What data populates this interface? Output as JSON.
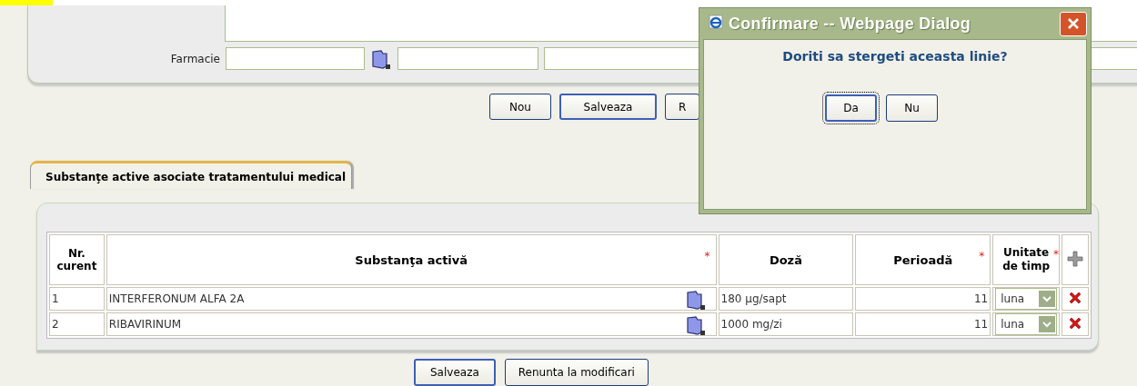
{
  "form": {
    "farmacie": {
      "label": "Farmacie"
    },
    "buttons": [
      {
        "label": "Nou",
        "default": false
      },
      {
        "label": "Salveaza",
        "default": true
      },
      {
        "label": "R",
        "default": false
      }
    ]
  },
  "tabs": [
    {
      "label": "Substanţe active asociate tratamentului medical",
      "selected": true
    }
  ],
  "table": {
    "columns": [
      {
        "label": "Nr. curent"
      },
      {
        "label": "Substanţa activă",
        "required_mark": "*"
      },
      {
        "label": "Doză"
      },
      {
        "label": "Perioadă",
        "required_mark": "*"
      },
      {
        "label": "Unitate de timp",
        "required_mark": "*"
      }
    ],
    "rows": [
      {
        "nr": "1",
        "substanta": "INTERFERONUM ALFA 2A",
        "doza": "180 µg/sapt",
        "perioada": "11",
        "unitate": "luna"
      },
      {
        "nr": "2",
        "substanta": "RIBAVIRINUM",
        "doza": "1000 mg/zi",
        "perioada": "11",
        "unitate": "luna"
      }
    ]
  },
  "bottom_buttons": [
    {
      "label": "Salveaza",
      "default": true
    },
    {
      "label": "Renunta la modificari",
      "default": false
    }
  ],
  "dialog": {
    "title": "Confirmare -- Webpage Dialog",
    "message": "Doriti sa stergeti aceasta linie?",
    "buttons": [
      {
        "label": "Da",
        "focused": true
      },
      {
        "label": "Nu",
        "focused": false
      }
    ]
  }
}
